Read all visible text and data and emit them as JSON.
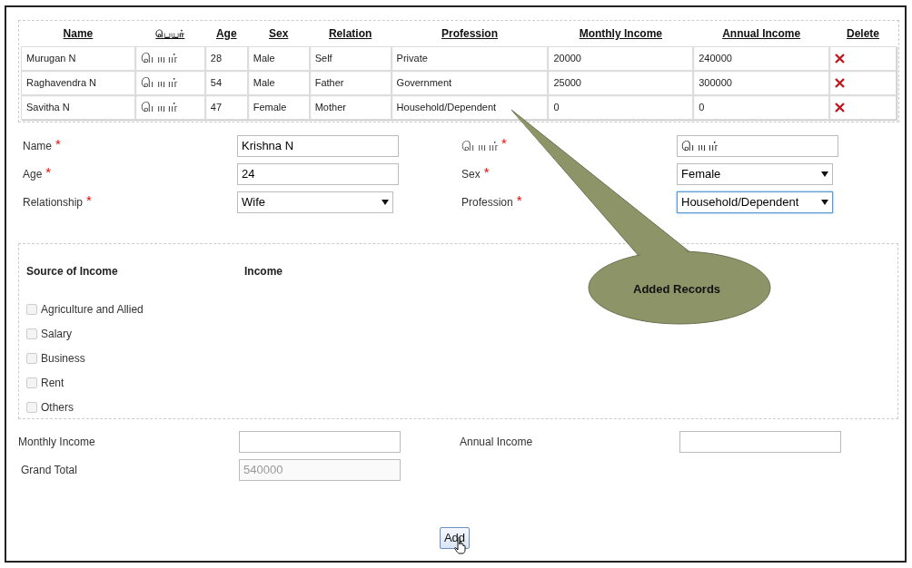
{
  "table": {
    "columns": [
      "Name",
      "பெயர்",
      "Age",
      "Sex",
      "Relation",
      "Profession",
      "Monthly Income",
      "Annual Income",
      "Delete"
    ],
    "rows": [
      {
        "cells": [
          "Murugan N",
          "பெயர்",
          "28",
          "Male",
          "Self",
          "Private",
          "20000",
          "240000"
        ]
      },
      {
        "cells": [
          "Raghavendra N",
          "பெயர்",
          "54",
          "Male",
          "Father",
          "Government",
          "25000",
          "300000"
        ]
      },
      {
        "cells": [
          "Savitha N",
          "பெயர்",
          "47",
          "Female",
          "Mother",
          "Household/Dependent",
          "0",
          "0"
        ]
      }
    ]
  },
  "form": {
    "fields": [
      {
        "label": "Name",
        "required_mark": "*",
        "kind": "text",
        "value": "Krishna N",
        "focused": false
      },
      {
        "label": "பெயர்",
        "required_mark": "*",
        "kind": "text",
        "value": "பெயர்",
        "focused": false
      },
      {
        "label": "Age",
        "required_mark": "*",
        "kind": "text",
        "value": "24",
        "focused": false
      },
      {
        "label": "Sex",
        "required_mark": "*",
        "kind": "select",
        "value": "Female",
        "focused": false
      },
      {
        "label": "Relationship",
        "required_mark": "*",
        "kind": "select",
        "value": "Wife",
        "focused": false
      },
      {
        "label": "Profession",
        "required_mark": "*",
        "kind": "select",
        "value": "Household/Dependent",
        "focused": true
      }
    ]
  },
  "income": {
    "headers": [
      "Source of Income",
      "Income"
    ],
    "sources": [
      {
        "label": "Agriculture and Allied",
        "checked": false
      },
      {
        "label": "Salary",
        "checked": false
      },
      {
        "label": "Business",
        "checked": false
      },
      {
        "label": "Rent",
        "checked": false
      },
      {
        "label": "Others",
        "checked": false
      }
    ]
  },
  "totals": [
    {
      "label": "Monthly Income"
    },
    {
      "label": "Annual Income"
    },
    {
      "label": "Grand Total",
      "value": "540000",
      "disabled": true
    }
  ],
  "add_button": "Add",
  "callout": "Added Records"
}
